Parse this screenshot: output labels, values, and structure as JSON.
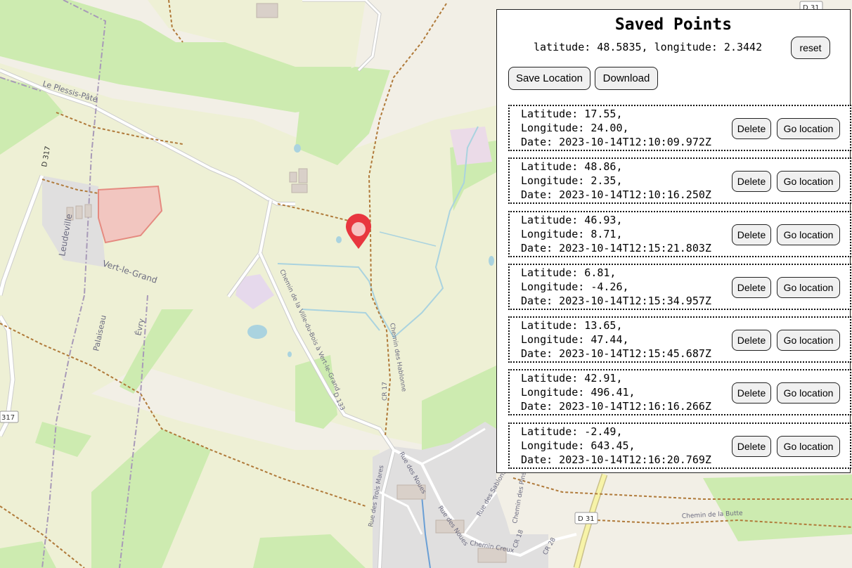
{
  "panel": {
    "title": "Saved Points",
    "coords_readout": "latitude: 48.5835, longitude: 2.3442",
    "reset_label": "reset",
    "save_label": "Save Location",
    "download_label": "Download",
    "delete_label": "Delete",
    "go_label": "Go location"
  },
  "points": [
    {
      "lat": "Latitude: 17.55,",
      "lon": "Longitude: 24.00,",
      "date": "Date: 2023-10-14T12:10:09.972Z"
    },
    {
      "lat": "Latitude: 48.86,",
      "lon": "Longitude: 2.35,",
      "date": "Date: 2023-10-14T12:10:16.250Z"
    },
    {
      "lat": "Latitude: 46.93,",
      "lon": "Longitude: 8.71,",
      "date": "Date: 2023-10-14T12:15:21.803Z"
    },
    {
      "lat": "Latitude: 6.81,",
      "lon": "Longitude: -4.26,",
      "date": "Date: 2023-10-14T12:15:34.957Z"
    },
    {
      "lat": "Latitude: 13.65,",
      "lon": "Longitude: 47.44,",
      "date": "Date: 2023-10-14T12:15:45.687Z"
    },
    {
      "lat": "Latitude: 42.91,",
      "lon": "Longitude: 496.41,",
      "date": "Date: 2023-10-14T12:16:16.266Z"
    },
    {
      "lat": "Latitude: -2.49,",
      "lon": "Longitude: 643.45,",
      "date": "Date: 2023-10-14T12:16:20.769Z"
    }
  ],
  "map": {
    "place_labels": {
      "le_plessis_pate": "Le Plessis-Pâté",
      "leudeville": "Leudeville",
      "vert_le_grand": "Vert-le-Grand",
      "palaiseau": "Palaiseau",
      "evry": "Évry",
      "chemin_ville_du_bois": "Chemin de la Ville-du-Bois à Vert-le-Grand",
      "chemin_des_hablonne": "Chemin des Hablonne",
      "chemin_de_la_butte": "Chemin de la Butte",
      "rue_des_trois_mares": "Rue des Trois Mares",
      "rue_des_noues_1": "Rue des Noues",
      "rue_des_noues_2": "Rue des Noues",
      "rue_des_sablons": "Rue des Sablons",
      "chemin_des_pins": "Chemin des Pins",
      "chemin_creux": "Chemin Creux",
      "cr17": "CR 17",
      "cr18": "CR 18",
      "cr28": "CR 28",
      "d133": "D 133"
    },
    "shields": {
      "d31_top": "D 31",
      "d31_bottom": "D 31",
      "d317_left": "317",
      "d317_vertical": "D 317"
    },
    "marker_icon": "map-pin-icon",
    "colors": {
      "land": "#f2efe6",
      "farmland": "#eef0d5",
      "grass": "#cdebb0",
      "water": "#aad3df",
      "marker": "#e8363f"
    }
  }
}
